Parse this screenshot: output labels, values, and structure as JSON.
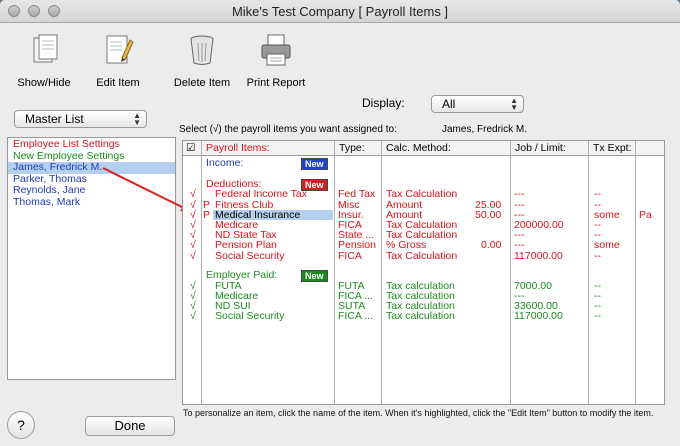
{
  "window": {
    "title": "Mike's Test Company [ Payroll Items ]"
  },
  "toolbar": {
    "show_hide": "Show/Hide",
    "edit_item": "Edit Item",
    "delete_item": "Delete Item",
    "print_report": "Print Report"
  },
  "master_list": {
    "value": "Master List"
  },
  "display": {
    "label": "Display:",
    "value": "All"
  },
  "instruction": "Select (√) the payroll items you want assigned to:",
  "assigned_to": "James, Fredrick M.",
  "employee_list": [
    {
      "label": "Employee List Settings"
    },
    {
      "label": "New Employee Settings"
    },
    {
      "label": "James, Fredrick M."
    },
    {
      "label": "Parker, Thomas"
    },
    {
      "label": "Reynolds, Jane"
    },
    {
      "label": "Thomas, Mark"
    }
  ],
  "grid": {
    "headers": {
      "check": "☑",
      "payroll_items": "Payroll Items:",
      "type": "Type:",
      "calc_method": "Calc. Method:",
      "job_limit": "Job / Limit:",
      "tx_expt": "Tx Expt:"
    },
    "sections": {
      "income": {
        "label": "Income:",
        "new": "New"
      },
      "deductions": {
        "label": "Deductions:",
        "new": "New"
      },
      "employer_paid": {
        "label": "Employer Paid:",
        "new": "New"
      }
    },
    "deductions": [
      {
        "check": "√",
        "flag": "",
        "name": "Federal Income Tax",
        "type": "Fed Tax",
        "method": "Tax Calculation",
        "amount": "",
        "limit": "---",
        "tx": "--",
        "extra": ""
      },
      {
        "check": "√",
        "flag": "P",
        "name": "Fitness Club",
        "type": "Misc",
        "method": "Amount",
        "amount": "25.00",
        "limit": "---",
        "tx": "--",
        "extra": ""
      },
      {
        "check": "√",
        "flag": "P",
        "name": "Medical Insurance",
        "type": "Insur.",
        "method": "Amount",
        "amount": "50.00",
        "limit": "---",
        "tx": "some",
        "extra": "Pa"
      },
      {
        "check": "√",
        "flag": "",
        "name": "Medicare",
        "type": "FICA",
        "method": "Tax Calculation",
        "amount": "",
        "limit": "200000.00",
        "tx": "--",
        "extra": ""
      },
      {
        "check": "√",
        "flag": "",
        "name": "ND State Tax",
        "type": "State ...",
        "method": "Tax Calculation",
        "amount": "",
        "limit": "---",
        "tx": "--",
        "extra": ""
      },
      {
        "check": "√",
        "flag": "",
        "name": "Pension Plan",
        "type": "Pension",
        "method": "% Gross",
        "amount": "0.00",
        "limit": "---",
        "tx": "some",
        "extra": ""
      },
      {
        "check": "√",
        "flag": "",
        "name": "Social Security",
        "type": "FICA",
        "method": "Tax Calculation",
        "amount": "",
        "limit": "117000.00",
        "tx": "--",
        "extra": ""
      }
    ],
    "employer_paid": [
      {
        "check": "√",
        "name": "FUTA",
        "type": "FUTA",
        "method": "Tax calculation",
        "limit": "7000.00",
        "tx": "--"
      },
      {
        "check": "√",
        "name": "Medicare",
        "type": "FICA ...",
        "method": "Tax calculation",
        "limit": "---",
        "tx": "--"
      },
      {
        "check": "√",
        "name": "ND SUI",
        "type": "SUTA",
        "method": "Tax calculation",
        "limit": "33600.00",
        "tx": "--"
      },
      {
        "check": "√",
        "name": "Social Security",
        "type": "FICA ...",
        "method": "Tax calculation",
        "limit": "117000.00",
        "tx": "--"
      }
    ]
  },
  "footer_text": "To personalize an item, click the name of the item.  When it's highlighted, click the \"Edit Item\" button to modify the item.",
  "buttons": {
    "help": "?",
    "done": "Done"
  },
  "colors": {
    "red": "#d9141c",
    "green": "#1c8a1f",
    "blue": "#1f3bb5",
    "selection": "#b5d0ee"
  }
}
